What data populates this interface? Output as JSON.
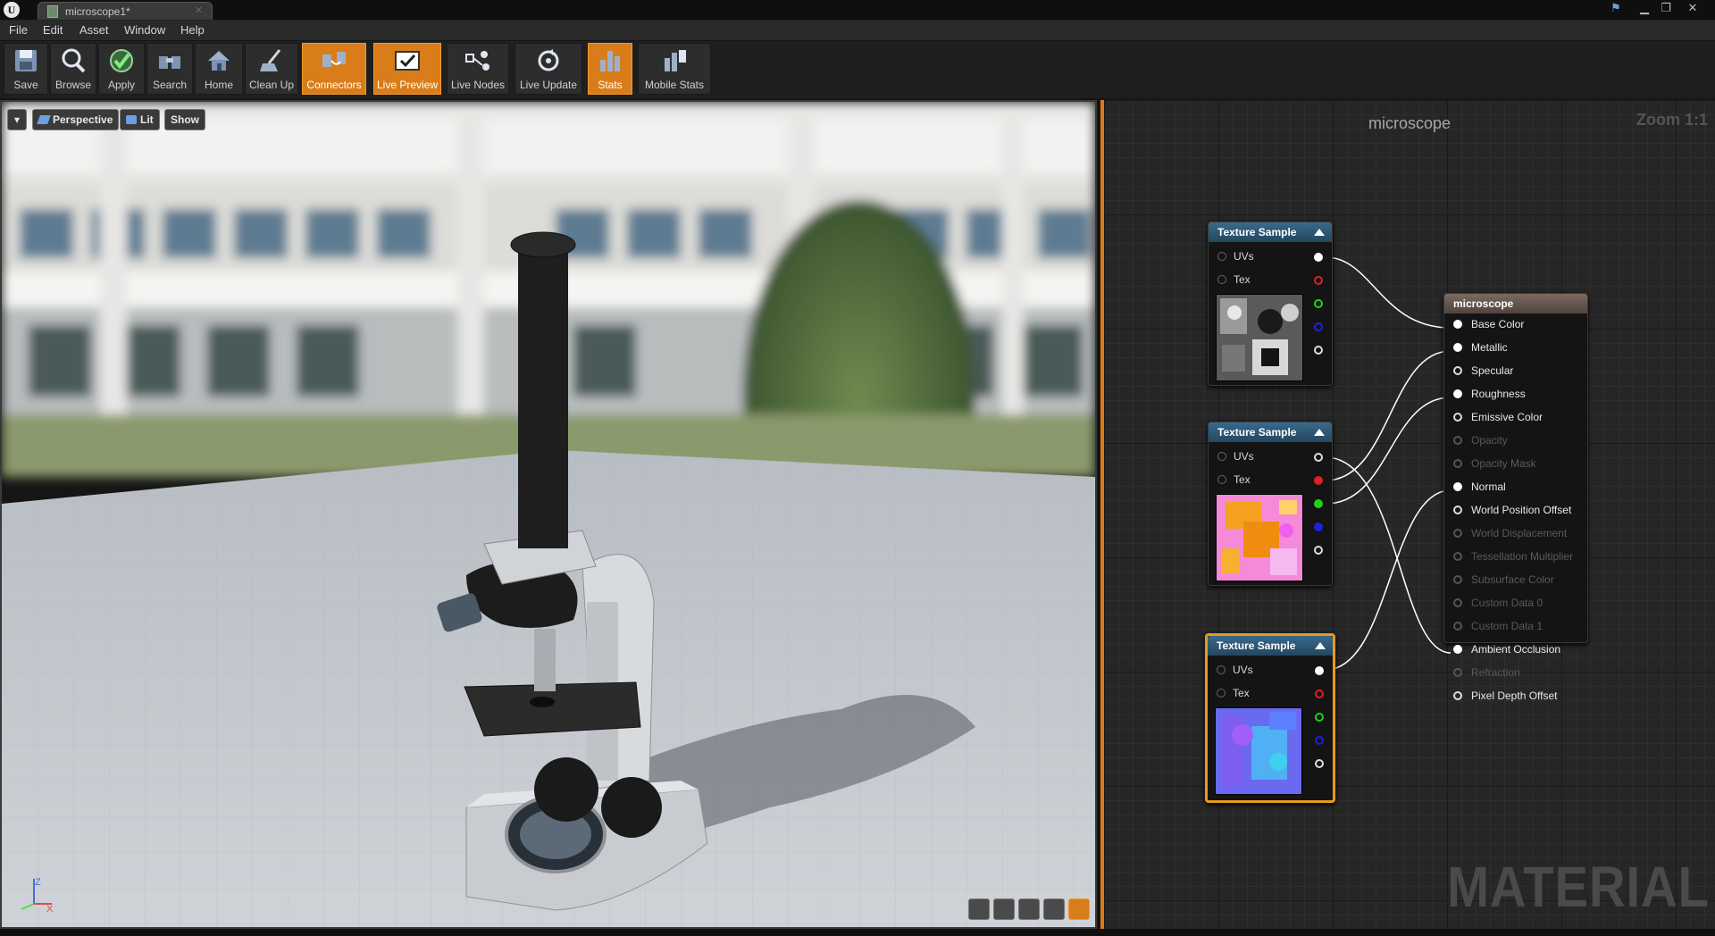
{
  "window": {
    "tab_title": "microscope1*",
    "logo": "U"
  },
  "menu": [
    "File",
    "Edit",
    "Asset",
    "Window",
    "Help"
  ],
  "toolbar": [
    {
      "label": "Save",
      "icon": "save-icon",
      "active": false
    },
    {
      "label": "Browse",
      "icon": "browse-icon",
      "active": false
    },
    {
      "label": "Apply",
      "icon": "apply-icon",
      "active": false
    },
    {
      "label": "Search",
      "icon": "search-icon",
      "active": false
    },
    {
      "label": "Home",
      "icon": "home-icon",
      "active": false
    },
    {
      "label": "Clean Up",
      "icon": "cleanup-icon",
      "active": false
    },
    {
      "label": "Connectors",
      "icon": "connectors-icon",
      "active": true
    },
    {
      "label": "Live Preview",
      "icon": "live-preview-icon",
      "active": true
    },
    {
      "label": "Live Nodes",
      "icon": "live-nodes-icon",
      "active": false
    },
    {
      "label": "Live Update",
      "icon": "live-update-icon",
      "active": false
    },
    {
      "label": "Stats",
      "icon": "stats-icon",
      "active": true
    },
    {
      "label": "Mobile Stats",
      "icon": "mobile-stats-icon",
      "active": false
    }
  ],
  "viewport": {
    "perspective": "Perspective",
    "lit": "Lit",
    "show": "Show",
    "axis_z": "Z",
    "axis_x": "X"
  },
  "graph": {
    "title": "microscope",
    "zoom": "Zoom 1:1",
    "watermark": "MATERIAL",
    "texture_nodes": [
      {
        "title": "Texture Sample",
        "inputs": [
          "UVs",
          "Tex"
        ],
        "thumb": "base-color"
      },
      {
        "title": "Texture Sample",
        "inputs": [
          "UVs",
          "Tex"
        ],
        "thumb": "orm"
      },
      {
        "title": "Texture Sample",
        "inputs": [
          "UVs",
          "Tex"
        ],
        "thumb": "normal",
        "selected": true
      }
    ],
    "result_node": {
      "title": "microscope",
      "pins": [
        {
          "label": "Base Color",
          "state": "connected"
        },
        {
          "label": "Metallic",
          "state": "connected"
        },
        {
          "label": "Specular",
          "state": "open"
        },
        {
          "label": "Roughness",
          "state": "connected"
        },
        {
          "label": "Emissive Color",
          "state": "open"
        },
        {
          "label": "Opacity",
          "state": "disabled"
        },
        {
          "label": "Opacity Mask",
          "state": "disabled"
        },
        {
          "label": "Normal",
          "state": "connected"
        },
        {
          "label": "World Position Offset",
          "state": "open"
        },
        {
          "label": "World Displacement",
          "state": "disabled"
        },
        {
          "label": "Tessellation Multiplier",
          "state": "disabled"
        },
        {
          "label": "Subsurface Color",
          "state": "disabled"
        },
        {
          "label": "Custom Data 0",
          "state": "disabled"
        },
        {
          "label": "Custom Data 1",
          "state": "disabled"
        },
        {
          "label": "Ambient Occlusion",
          "state": "connected"
        },
        {
          "label": "Refraction",
          "state": "disabled"
        },
        {
          "label": "Pixel Depth Offset",
          "state": "open"
        }
      ]
    }
  },
  "colors": {
    "accent": "#d97d1a",
    "node_header": "#2f5a78",
    "result_header": "#6a5b52",
    "pin_r": "#e02020",
    "pin_g": "#20d020",
    "pin_b": "#2020e0"
  }
}
